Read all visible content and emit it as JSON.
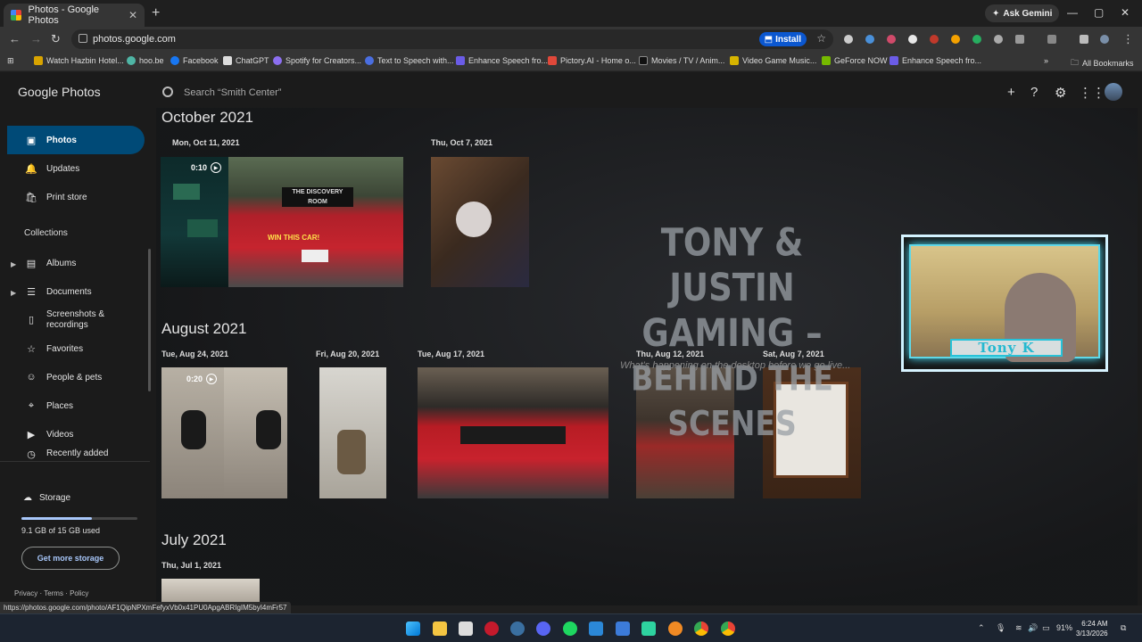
{
  "browser": {
    "tab_title": "Photos - Google Photos",
    "tab_close": "✕",
    "new_tab": "+",
    "ask_gemini": "Ask Gemini",
    "url": "photos.google.com",
    "install_label": "Install",
    "window_min": "—",
    "window_max": "▢",
    "window_close": "✕",
    "bookmarks": [
      "Watch Hazbin Hotel...",
      "hoo.be",
      "Facebook",
      "ChatGPT",
      "Spotify for Creators...",
      "Text to Speech with...",
      "Enhance Speech fro...",
      "Pictory.AI - Home o...",
      "Movies / TV / Anim...",
      "Video Game Music...",
      "GeForce NOW",
      "Enhance Speech fro..."
    ],
    "all_bookmarks": "All Bookmarks",
    "status_url": "https://photos.google.com/photo/AF1QipNPXmFefyxVb0x41PU0ApgABRIgIM5byI4mFr57"
  },
  "app": {
    "logo_google": "Google",
    "logo_photos": "Photos",
    "search_placeholder": "Search “Smith Center”"
  },
  "sidebar": {
    "items": [
      {
        "label": "Photos",
        "icon": "▣"
      },
      {
        "label": "Updates",
        "icon": "🔔"
      },
      {
        "label": "Print store",
        "icon": "🛍"
      }
    ],
    "collections_label": "Collections",
    "collections": [
      {
        "label": "Albums",
        "icon": "▤"
      },
      {
        "label": "Documents",
        "icon": "☰"
      },
      {
        "label": "Screenshots & recordings",
        "icon": "▯"
      },
      {
        "label": "Favorites",
        "icon": "☆"
      },
      {
        "label": "People & pets",
        "icon": "☺"
      },
      {
        "label": "Places",
        "icon": "⌖"
      },
      {
        "label": "Videos",
        "icon": "▶"
      },
      {
        "label": "Recently added",
        "icon": "◷"
      }
    ],
    "storage_label": "Storage",
    "storage_used": "9.1 GB of 15 GB used",
    "storage_fraction": 0.61,
    "get_more": "Get more storage",
    "legal": "Privacy · Terms · Policy"
  },
  "grid": {
    "months": [
      "October 2021",
      "August 2021",
      "July 2021"
    ],
    "dates": [
      "Mon, Oct 11, 2021",
      "Thu, Oct 7, 2021",
      "Tue, Aug 24, 2021",
      "Fri, Aug 20, 2021",
      "Tue, Aug 17, 2021",
      "Thu, Aug 12, 2021",
      "Sat, Aug 7, 2021",
      "Thu, Jul 1, 2021"
    ],
    "durations": [
      "0:10",
      "0:20"
    ]
  },
  "overlay": {
    "title_line1": "TONY & JUSTIN",
    "title_line2": "GAMING –",
    "title_line3": "BEHIND THE SCENES",
    "subtitle": "What's happening on the desktop before we go live...",
    "webcam_name": "Tony K"
  },
  "taskbar": {
    "time": "6:24 AM",
    "date": "3/13/2026",
    "battery": "91%"
  },
  "colors": {
    "accent": "#004a77",
    "link": "#a8c7fa",
    "background": "#1b1b1b"
  }
}
